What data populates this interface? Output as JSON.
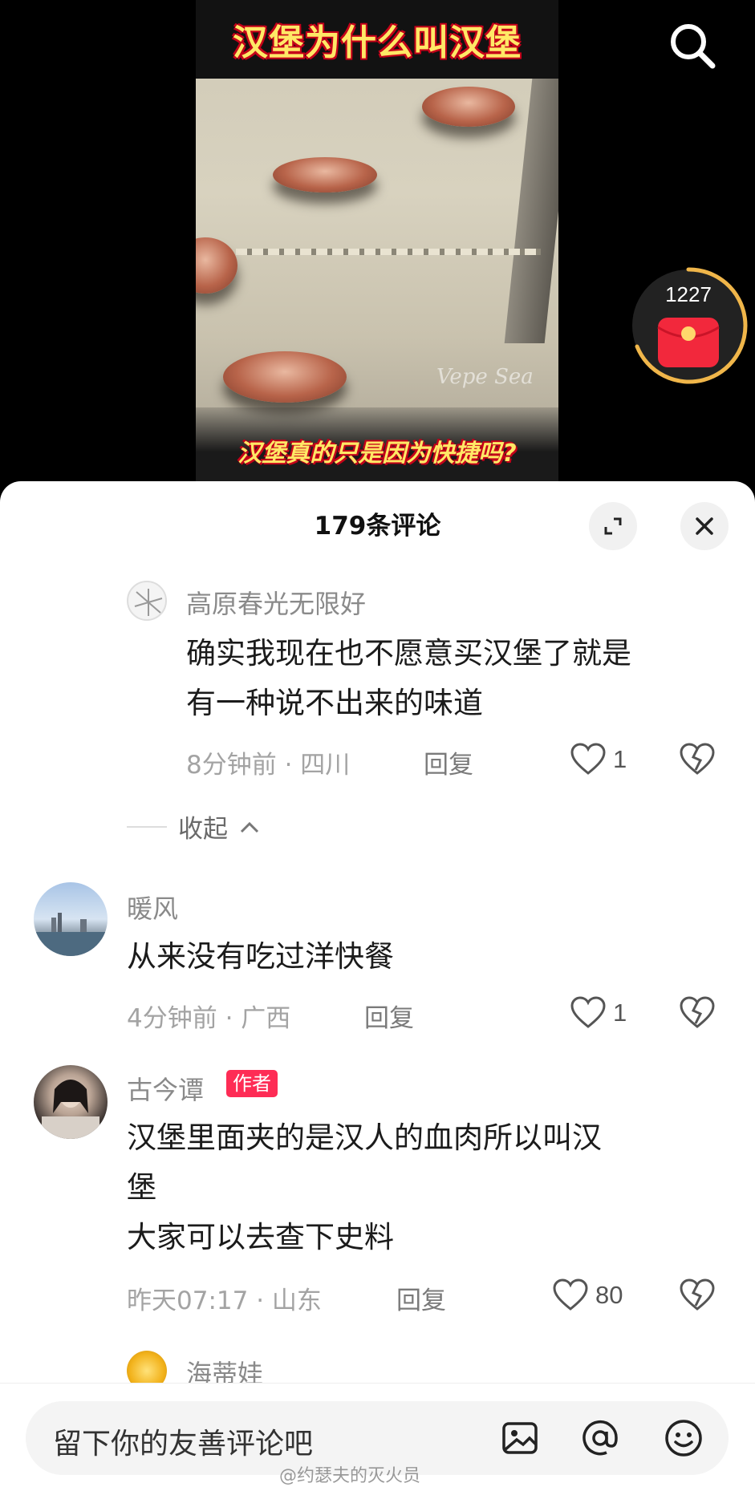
{
  "video": {
    "title": "汉堡为什么叫汉堡",
    "caption": "汉堡真的只是因为快捷吗?",
    "watermark": "Vepe Sea"
  },
  "overlay": {
    "search_icon": "search-icon",
    "redpacket_count": "1227",
    "redpacket_icon": "red-envelope-icon"
  },
  "sheet": {
    "title": "179条评论"
  },
  "comments": [
    {
      "username": "高原春光无限好",
      "text_lines": [
        "确实我现在也不愿意买汉堡了就是",
        "有一种说不出来的味道"
      ],
      "meta": "8分钟前 · 四川",
      "reply": "回复",
      "likes": "1"
    },
    {
      "username": "暖风",
      "text_lines": [
        "从来没有吃过洋快餐"
      ],
      "meta": "4分钟前 · 广西",
      "reply": "回复",
      "likes": "1"
    },
    {
      "username": "古今谭",
      "badge": "作者",
      "text_lines": [
        "汉堡里面夹的是汉人的血肉所以叫汉",
        "堡",
        "大家可以去查下史料"
      ],
      "meta": "昨天07:17 · 山东",
      "reply": "回复",
      "likes": "80"
    },
    {
      "username": "海蒂娃"
    }
  ],
  "collapse": {
    "label": "收起"
  },
  "input": {
    "placeholder": "留下你的友善评论吧"
  },
  "watermark": "@约瑟夫的灭火员",
  "colors": {
    "accent": "#fe2c55",
    "sheet_bg": "#ffffff"
  }
}
